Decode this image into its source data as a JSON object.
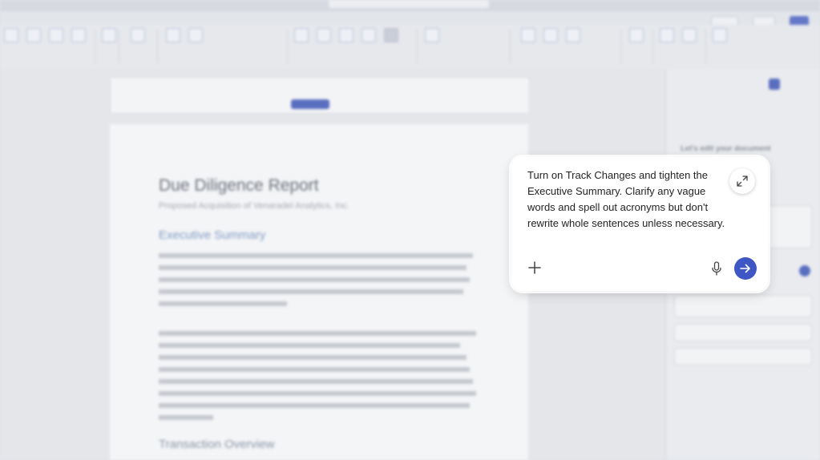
{
  "document": {
    "title": "Due Diligence Report",
    "subtitle": "Proposed Acquisition of Venaradel Analytics, Inc.",
    "section1_heading": "Executive Summary",
    "section2_heading": "Transaction Overview"
  },
  "composer": {
    "message": "Turn on Track Changes and tighten the Executive Summary. Clarify any vague words and spell out acronyms but don't rewrite whole sentences unless necessary."
  },
  "side_panel": {
    "heading": "Let's edit your document"
  },
  "colors": {
    "send_button": "#3e57c4",
    "composer_bg": "#ffffff",
    "message_text": "#242424"
  }
}
